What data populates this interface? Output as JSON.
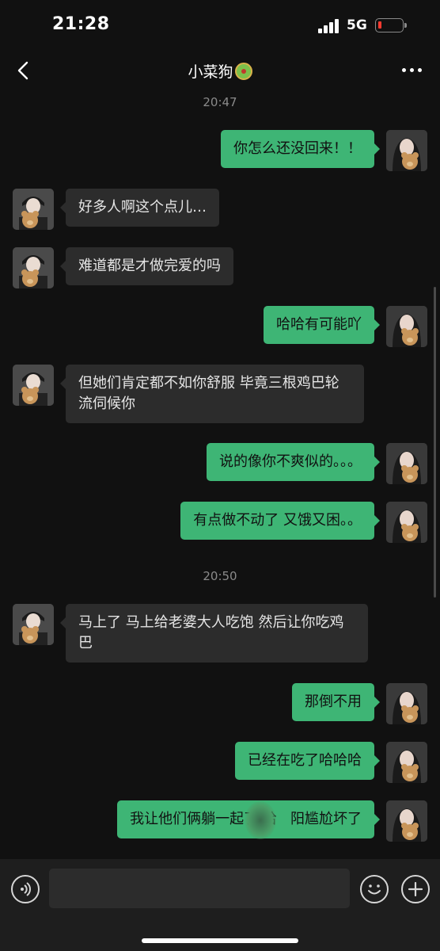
{
  "status_bar": {
    "time": "21:28",
    "network": "5G",
    "battery_level": 0.1,
    "battery_color": "#ff3b30"
  },
  "nav": {
    "title": "小菜狗",
    "back_icon": "chevron-left-icon",
    "more_icon": "more-dots-icon",
    "title_emoji": "emoji-badge-icon"
  },
  "chat": {
    "timestamps": [
      "20:47",
      "20:50"
    ],
    "messages": [
      {
        "side": "out",
        "text": "你怎么还没回来！！"
      },
      {
        "side": "in",
        "text": "好多人啊这个点儿…"
      },
      {
        "side": "in",
        "text": "难道都是才做完爱的吗"
      },
      {
        "side": "out",
        "text": "哈哈有可能吖"
      },
      {
        "side": "in",
        "text": "但她们肯定都不如你舒服 毕竟三根鸡巴轮流伺候你"
      },
      {
        "side": "out",
        "text": "说的像你不爽似的。。。"
      },
      {
        "side": "out",
        "text": "有点做不动了 又饿又困。。"
      },
      {
        "side": "in",
        "text": "马上了 马上给老婆大人吃饱 然后让你吃鸡巴"
      },
      {
        "side": "out",
        "text": "那倒不用"
      },
      {
        "side": "out",
        "text": "已经在吃了哈哈哈"
      },
      {
        "side": "out",
        "text": "我让他们俩躺一起了 给   阳尴尬坏了"
      }
    ]
  },
  "colors": {
    "background": "#111111",
    "outgoing_bubble": "#3eb575",
    "incoming_bubble": "#2c2c2c",
    "input_bar": "#1e1e1e"
  },
  "input_bar": {
    "placeholder": "",
    "voice_icon": "voice-icon",
    "emoji_icon": "emoji-icon",
    "plus_icon": "plus-icon"
  }
}
